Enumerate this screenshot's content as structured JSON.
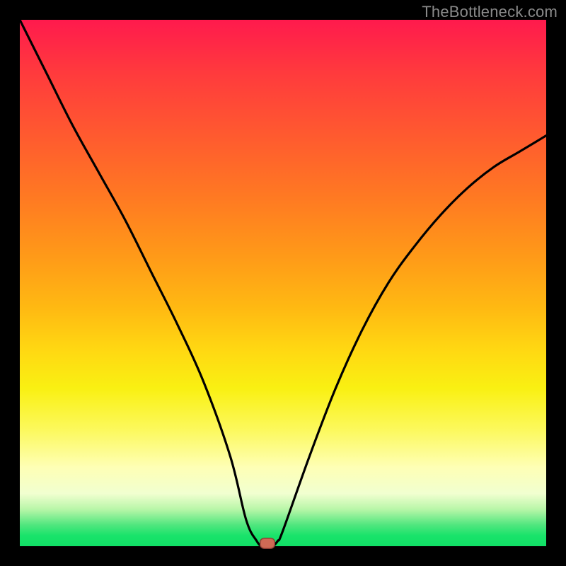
{
  "watermark": "TheBottleneck.com",
  "chart_data": {
    "type": "line",
    "title": "",
    "xlabel": "",
    "ylabel": "",
    "xlim": [
      0,
      100
    ],
    "ylim": [
      0,
      100
    ],
    "gradient_meaning": "bottleneck severity (top=red high, bottom=green low)",
    "series": [
      {
        "name": "bottleneck-curve",
        "x": [
          0,
          5,
          10,
          15,
          20,
          25,
          30,
          35,
          40,
          43,
          45,
          46,
          47,
          48,
          49,
          50,
          55,
          60,
          65,
          70,
          75,
          80,
          85,
          90,
          95,
          100
        ],
        "y": [
          100,
          90,
          80,
          71,
          62,
          52,
          42,
          31,
          17,
          5,
          1,
          0,
          0,
          0,
          1,
          3,
          17,
          30,
          41,
          50,
          57,
          63,
          68,
          72,
          75,
          78
        ]
      }
    ],
    "marker": {
      "x": 47,
      "y": 0,
      "color": "#cf6a55"
    }
  }
}
